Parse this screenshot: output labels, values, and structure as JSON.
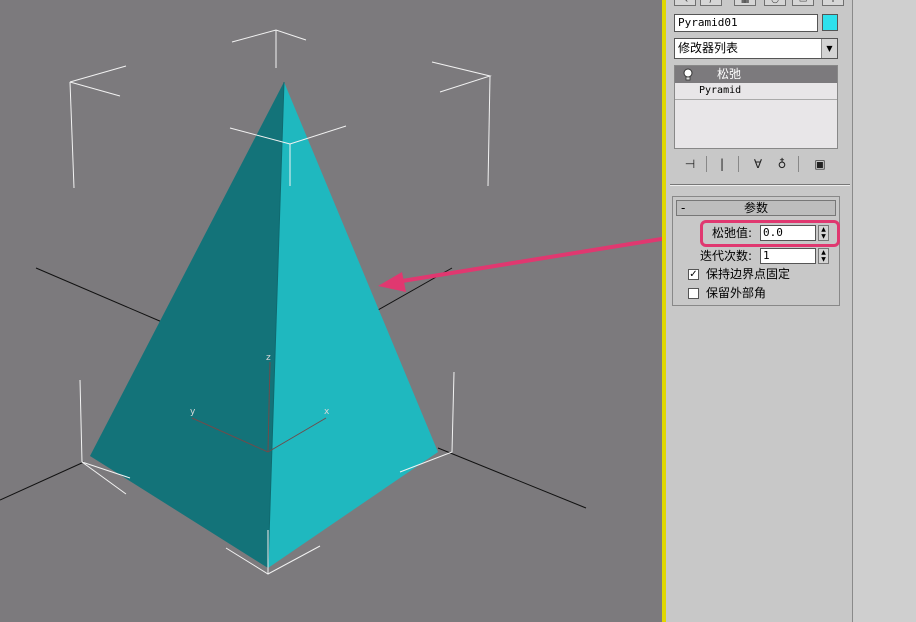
{
  "object": {
    "name": "Pyramid01",
    "color": "#2ee0ec"
  },
  "modifier_list": {
    "label": "修改器列表",
    "arrow": "▼"
  },
  "stack": {
    "items": [
      {
        "label": "松弛",
        "icon": "lightbulb-icon"
      },
      {
        "label": "Pyramid"
      }
    ]
  },
  "stack_tools": {
    "pin": "⊣",
    "show_end": "|",
    "unique": "∀",
    "remove": "♁",
    "configure": "▣"
  },
  "rollout": {
    "collapse": "-",
    "title": "参数",
    "relax_value_label": "松弛值:",
    "relax_value": "0.0",
    "iterations_label": "迭代次数:",
    "iterations": "1",
    "keep_boundary_label": "保持边界点固定",
    "keep_boundary_checked": "✓",
    "save_outer_label": "保留外部角"
  },
  "viewport": {
    "axis_x": "x",
    "axis_y": "y",
    "axis_z": "z",
    "pyramid_light": "#1fb8bf",
    "pyramid_dark": "#137379",
    "highlight": "#e03870"
  }
}
